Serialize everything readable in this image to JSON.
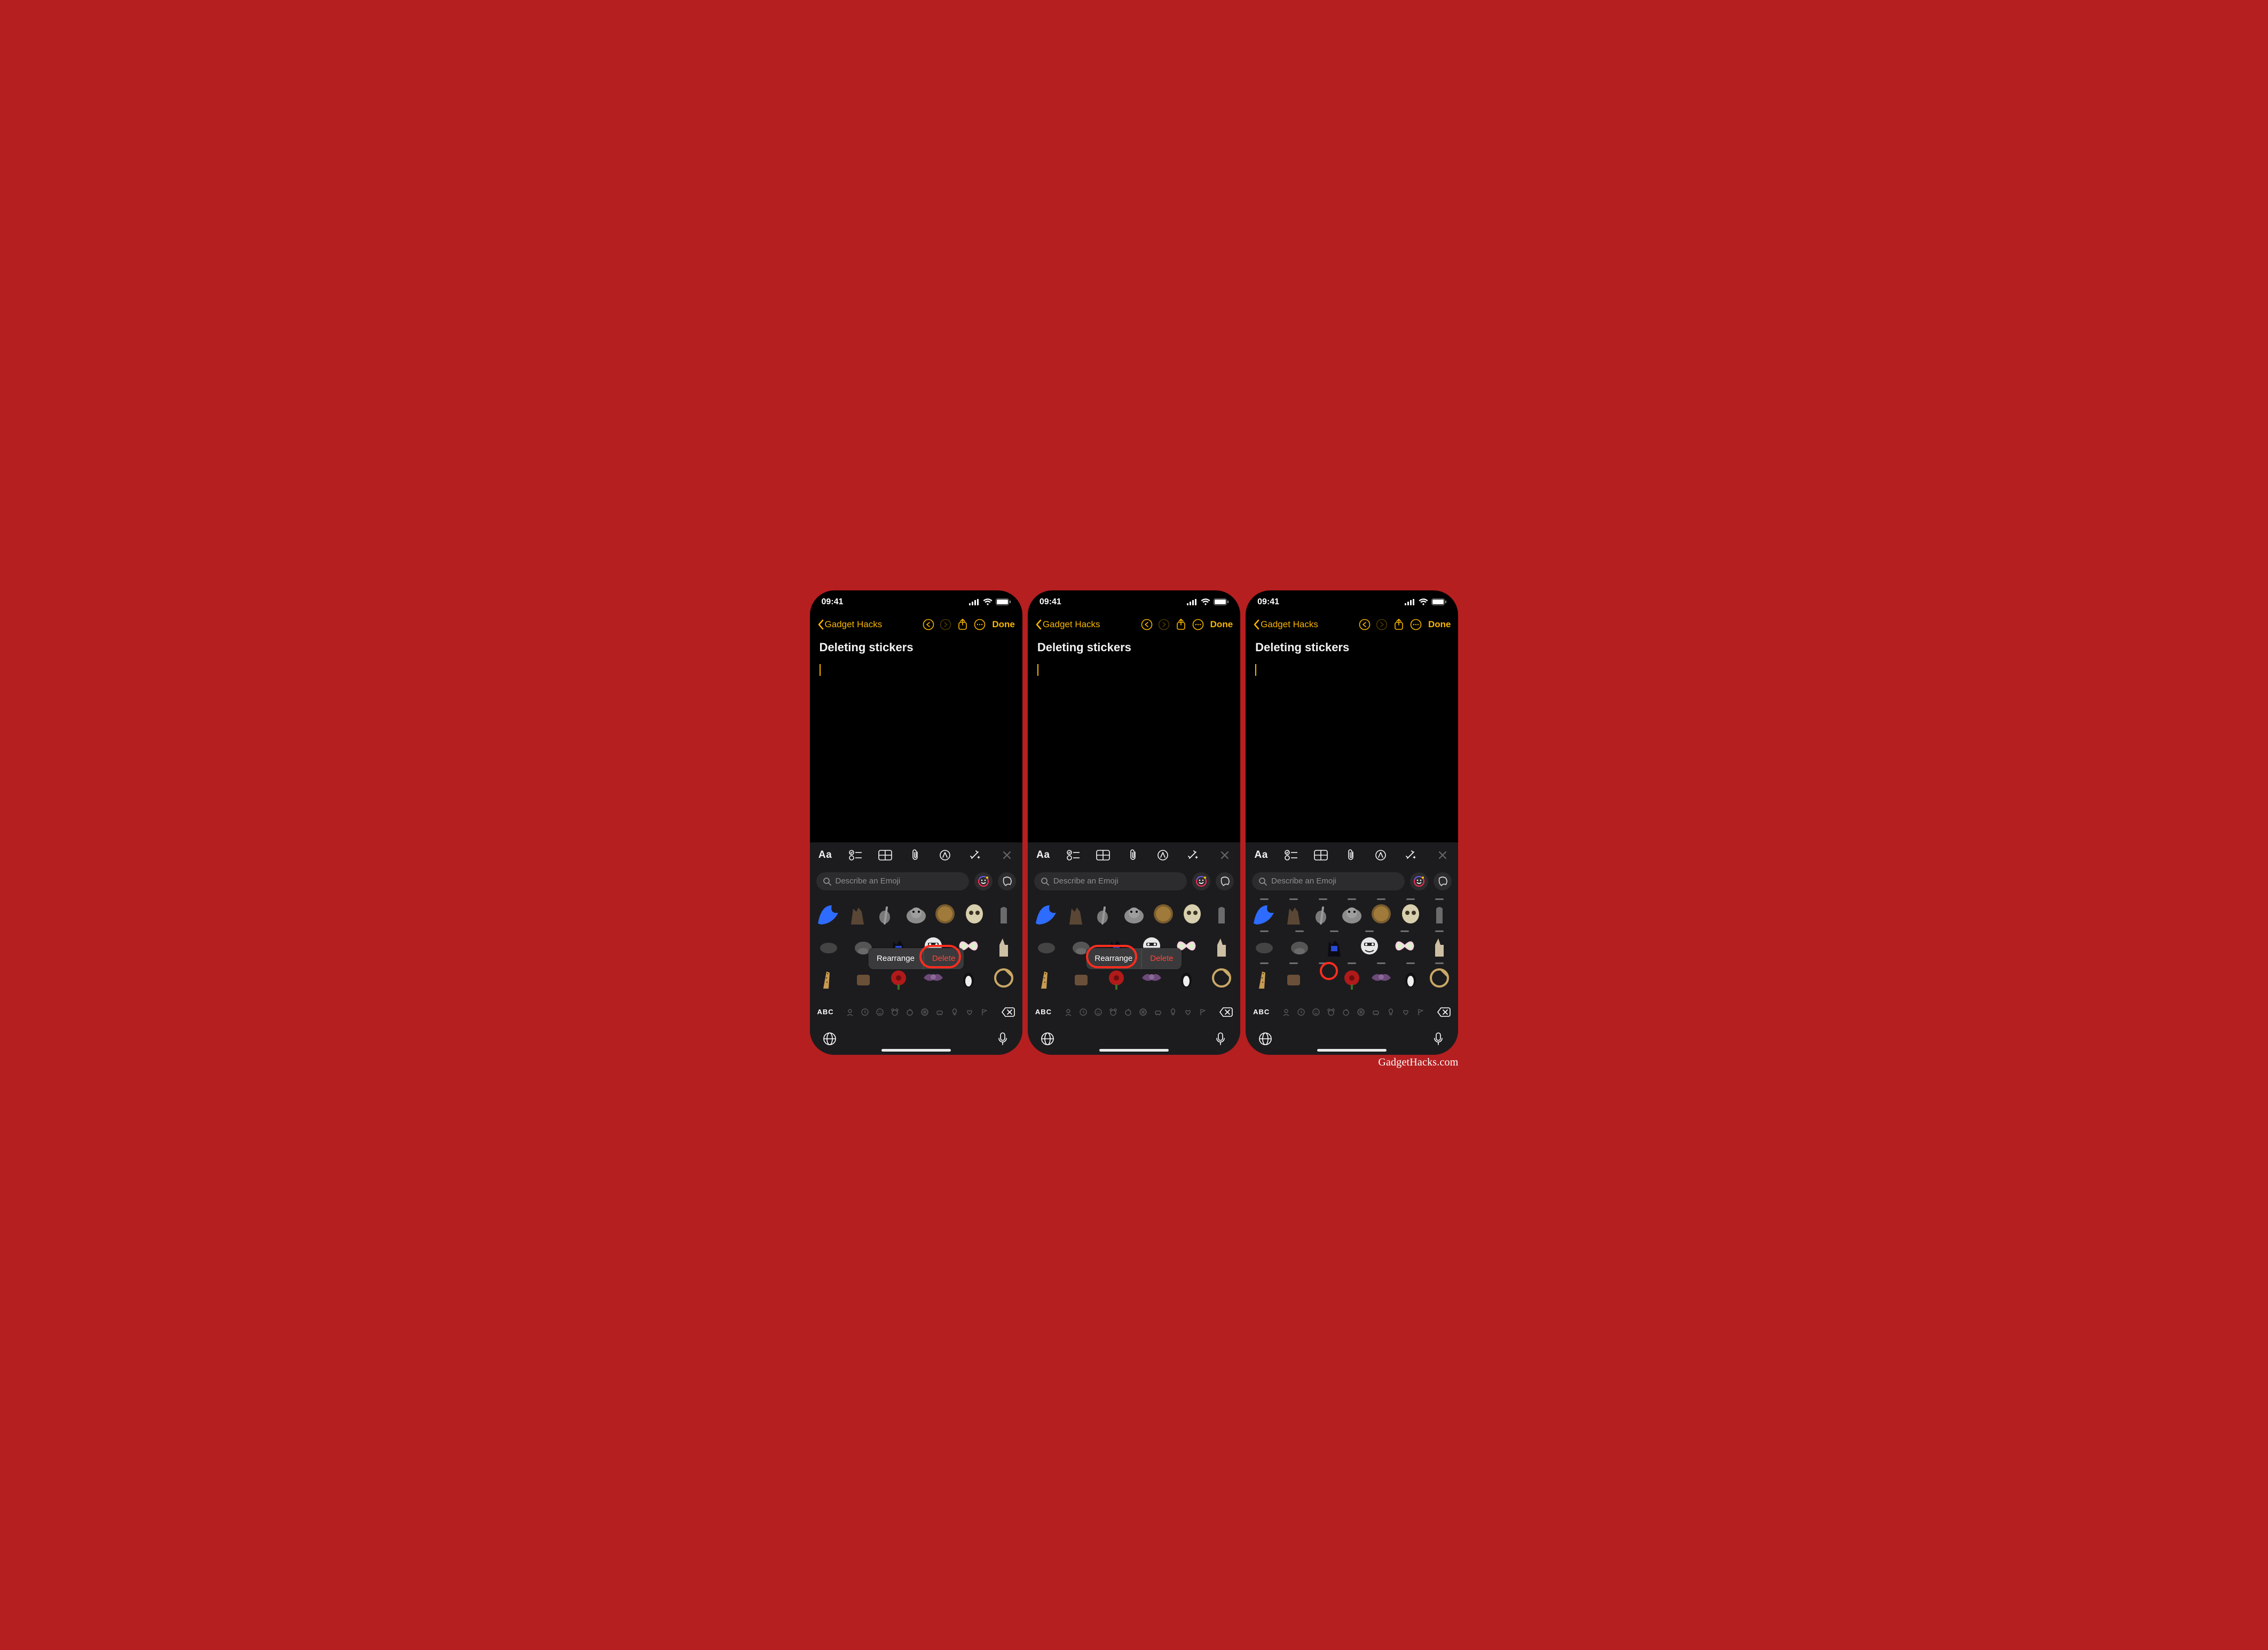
{
  "watermark": "GadgetHacks.com",
  "status": {
    "time": "09:41"
  },
  "nav": {
    "back": "Gadget Hacks",
    "done": "Done"
  },
  "note": {
    "title": "Deleting stickers"
  },
  "fmt": {
    "aa": "Aa"
  },
  "search": {
    "placeholder": "Describe an Emoji"
  },
  "ctx": {
    "rearrange": "Rearrange",
    "delete": "Delete"
  },
  "tabs": {
    "abc": "ABC"
  },
  "stickers": {
    "row0": [
      "wing",
      "cat",
      "rat",
      "elephant",
      "coin",
      "skull",
      "ghostkid"
    ],
    "row1": [
      "cow",
      "hippo",
      "blackcat",
      "moonface",
      "butterfly",
      "llama"
    ],
    "row2": [
      "giraffe",
      "dog",
      "redflower",
      "bat",
      "penguin",
      "cookie"
    ]
  }
}
